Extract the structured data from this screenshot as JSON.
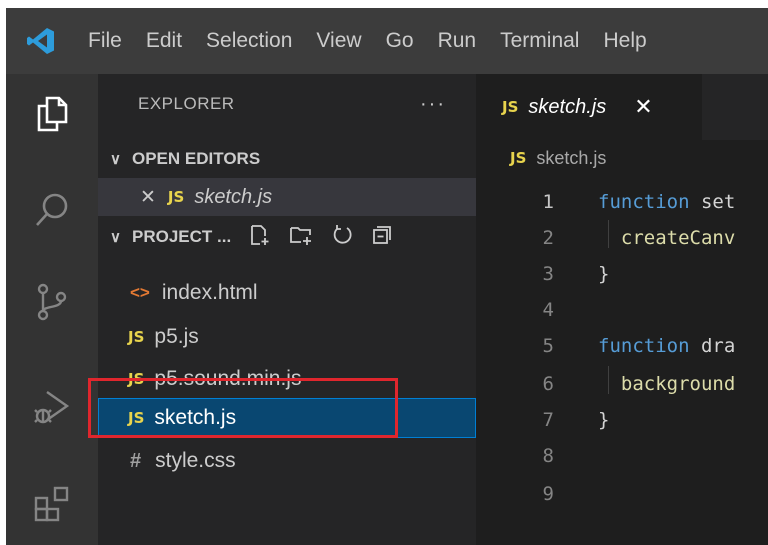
{
  "menu": {
    "items": [
      "File",
      "Edit",
      "Selection",
      "View",
      "Go",
      "Run",
      "Terminal",
      "Help"
    ]
  },
  "activity": {
    "icons": [
      "explorer-icon",
      "search-icon",
      "source-control-icon",
      "run-debug-icon",
      "extensions-icon"
    ]
  },
  "sidebar": {
    "title": "EXPLORER",
    "more": "···",
    "open_editors": {
      "label": "OPEN EDITORS",
      "items": [
        {
          "badge": "JS",
          "name": "sketch.js"
        }
      ]
    },
    "project": {
      "label": "PROJECT ...",
      "files": [
        {
          "badge": "<>",
          "name": "index.html",
          "type": "html"
        },
        {
          "badge": "JS",
          "name": "p5.js",
          "type": "js"
        },
        {
          "badge": "JS",
          "name": "p5.sound.min.js",
          "type": "js"
        },
        {
          "badge": "JS",
          "name": "sketch.js",
          "type": "js",
          "selected": true
        },
        {
          "badge": "#",
          "name": "style.css",
          "type": "css"
        }
      ]
    }
  },
  "editor": {
    "tab": {
      "badge": "JS",
      "name": "sketch.js",
      "close": "✕"
    },
    "breadcrumb": {
      "badge": "JS",
      "name": "sketch.js"
    },
    "line_numbers": [
      "1",
      "2",
      "3",
      "4",
      "5",
      "6",
      "7",
      "8",
      "9"
    ],
    "lines": [
      {
        "kw": "function",
        "rest": " set"
      },
      {
        "indent": "  ",
        "fn": "createCanv"
      },
      {
        "text": "}"
      },
      {
        "text": ""
      },
      {
        "kw": "function",
        "rest": " dra"
      },
      {
        "indent": "  ",
        "fn": "background"
      },
      {
        "text": "}"
      },
      {
        "text": ""
      },
      {
        "text": ""
      }
    ]
  },
  "colors": {
    "accent": "#007fd4",
    "highlight_box": "#e0262d",
    "js_badge": "#e8d44d"
  }
}
